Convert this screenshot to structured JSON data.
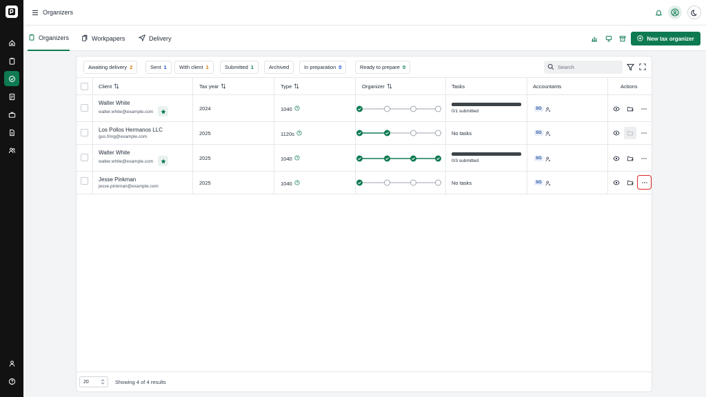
{
  "header": {
    "page_title": "Organizers"
  },
  "tabs": [
    {
      "label": "Organizers",
      "icon": "clipboard-icon",
      "active": true
    },
    {
      "label": "Workpapers",
      "icon": "files-icon",
      "active": false
    },
    {
      "label": "Delivery",
      "icon": "send-icon",
      "active": false
    }
  ],
  "actions": {
    "new_label": "New tax organizer"
  },
  "filters": [
    {
      "label": "Awaiting delivery",
      "count": "2",
      "color": "#d97706"
    },
    {
      "label": "Sent",
      "count": "1",
      "color": "#1d4ed8"
    },
    {
      "label": "With client",
      "count": "1",
      "color": "#d97706"
    },
    {
      "label": "Submitted",
      "count": "1",
      "color": "#0e7a52"
    },
    {
      "label": "Archived",
      "count": "",
      "color": "#1f2937"
    },
    {
      "label": "In preparation",
      "count": "0",
      "color": "#1d4ed8"
    },
    {
      "label": "Ready to prepare",
      "count": "0",
      "color": "#0e7a52"
    }
  ],
  "search": {
    "placeholder": "Search"
  },
  "columns": {
    "client": "Client",
    "tax_year": "Tax year",
    "type": "Type",
    "organizer": "Organizer",
    "tasks": "Tasks",
    "accountants": "Accountants",
    "actions": "Actions"
  },
  "rows": [
    {
      "name": "Walter White",
      "email": "walter.white@example.com",
      "starred": true,
      "tax_year": "2024",
      "type": "1040",
      "steps_done": 1,
      "tasks_text": "0/1 submitted",
      "has_bar": true,
      "accountant": "SG"
    },
    {
      "name": "Los Pollos Hermanos LLC",
      "email": "gus.fring@example.com",
      "starred": false,
      "tax_year": "2025",
      "type": "1120s",
      "steps_done": 2,
      "tasks_text": "No tasks",
      "has_bar": false,
      "accountant": "SG"
    },
    {
      "name": "Walter White",
      "email": "walter.white@example.com",
      "starred": true,
      "tax_year": "2025",
      "type": "1040",
      "steps_done": 4,
      "tasks_text": "0/3 submitted",
      "has_bar": true,
      "accountant": "SG"
    },
    {
      "name": "Jesse Pinkman",
      "email": "jesse.pinkman@example.com",
      "starred": false,
      "tax_year": "2025",
      "type": "1040",
      "steps_done": 1,
      "tasks_text": "No tasks",
      "has_bar": false,
      "accountant": "SG"
    }
  ],
  "footer": {
    "page_size": "20",
    "results_text": "Showing 4 of 4 results"
  },
  "colors": {
    "accent": "#0e7a52",
    "rail": "#121212",
    "highlight": "#dc2626"
  }
}
